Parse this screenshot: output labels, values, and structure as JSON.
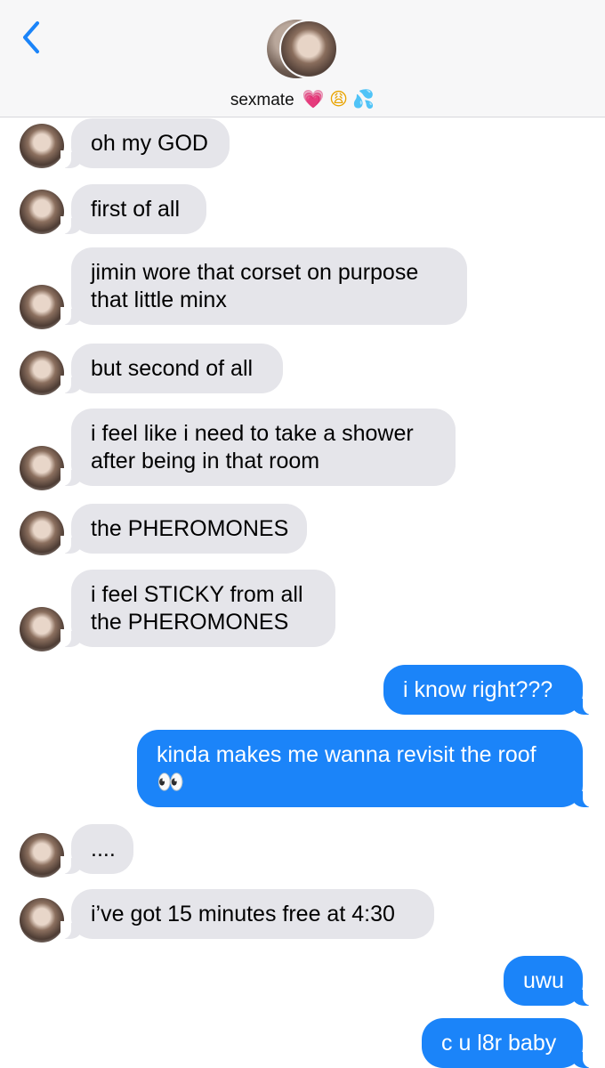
{
  "header": {
    "back_icon": "chevron-left-icon",
    "contact_name": "sexmate",
    "name_emojis": [
      "💗",
      "😩",
      "💦"
    ]
  },
  "messages": [
    {
      "from": "them",
      "lines": [
        "oh my GOD"
      ]
    },
    {
      "from": "them",
      "lines": [
        "first of all"
      ]
    },
    {
      "from": "them",
      "lines": [
        "jimin wore that corset on purpose",
        "that little minx"
      ]
    },
    {
      "from": "them",
      "lines": [
        "but second of all"
      ]
    },
    {
      "from": "them",
      "lines": [
        "i feel like i need to take a shower",
        "after being in that room"
      ]
    },
    {
      "from": "them",
      "lines": [
        "the PHEROMONES"
      ]
    },
    {
      "from": "them",
      "lines": [
        "i feel STICKY from all",
        "the PHEROMONES"
      ]
    },
    {
      "from": "me",
      "lines": [
        "i know right???"
      ]
    },
    {
      "from": "me",
      "lines": [
        "kinda makes me wanna revisit the roof",
        "👀"
      ]
    },
    {
      "from": "them",
      "lines": [
        "...."
      ]
    },
    {
      "from": "them",
      "lines": [
        "i’ve got 15 minutes free at 4:30"
      ]
    },
    {
      "from": "me",
      "lines": [
        "uwu"
      ]
    },
    {
      "from": "me",
      "lines": [
        "c u l8r baby"
      ]
    }
  ],
  "colors": {
    "incoming_bubble": "#e5e5ea",
    "outgoing_bubble": "#1b84f9",
    "accent": "#1b84f9"
  }
}
